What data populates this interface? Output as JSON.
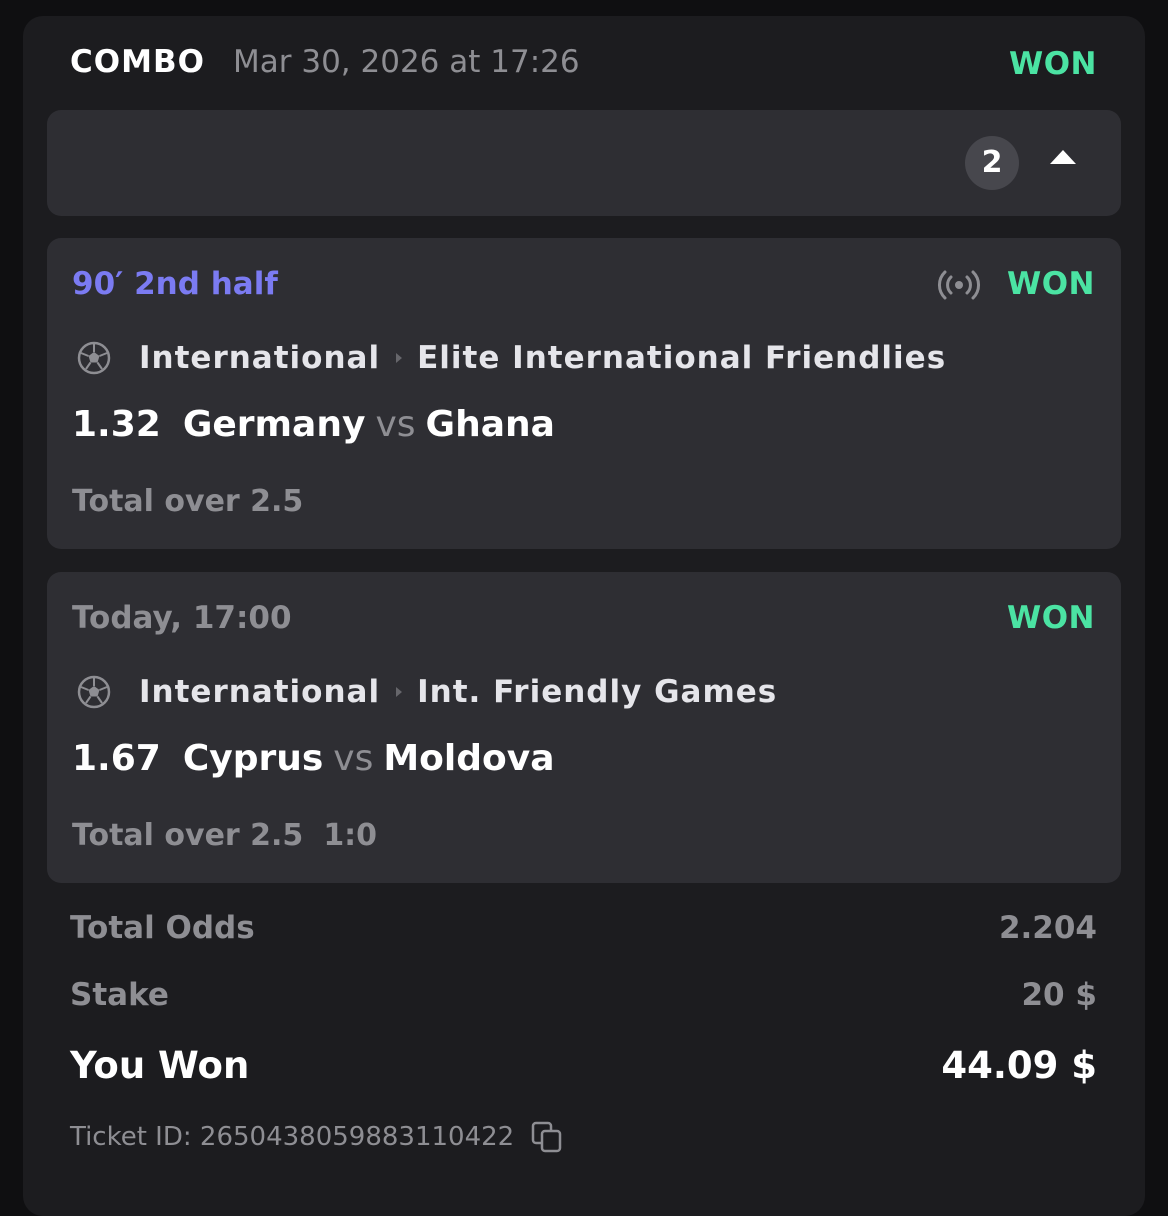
{
  "header": {
    "type": "COMBO",
    "date": "Mar 30, 2026 at 17:26",
    "status": "WON"
  },
  "selections": {
    "count": "2"
  },
  "legs": [
    {
      "time": "90′ 2nd half",
      "status": "WON",
      "live_icon": "live-broadcast-icon",
      "sport_icon": "soccer-ball-icon",
      "region": "International",
      "league": "Elite International Friendlies",
      "odds": "1.32",
      "home": "Germany",
      "vs": "vs",
      "away": "Ghana",
      "market": "Total over 2.5",
      "score": ""
    },
    {
      "time": "Today, 17:00",
      "status": "WON",
      "sport_icon": "soccer-ball-icon",
      "region": "International",
      "league": "Int. Friendly Games",
      "odds": "1.67",
      "home": "Cyprus",
      "vs": "vs",
      "away": "Moldova",
      "market": "Total over 2.5",
      "score": "1:0"
    }
  ],
  "summary": {
    "total_odds_label": "Total Odds",
    "total_odds_value": "2.204",
    "stake_label": "Stake",
    "stake_value": "20 $",
    "won_label": "You Won",
    "won_value": "44.09 $"
  },
  "ticket": {
    "label": "Ticket ID: 2650438059883110422"
  },
  "colors": {
    "won": "#4be3a3",
    "live_time": "#7b7bf2",
    "muted": "#8e8e93",
    "panel": "#2e2e33",
    "card": "#1c1c1f"
  }
}
